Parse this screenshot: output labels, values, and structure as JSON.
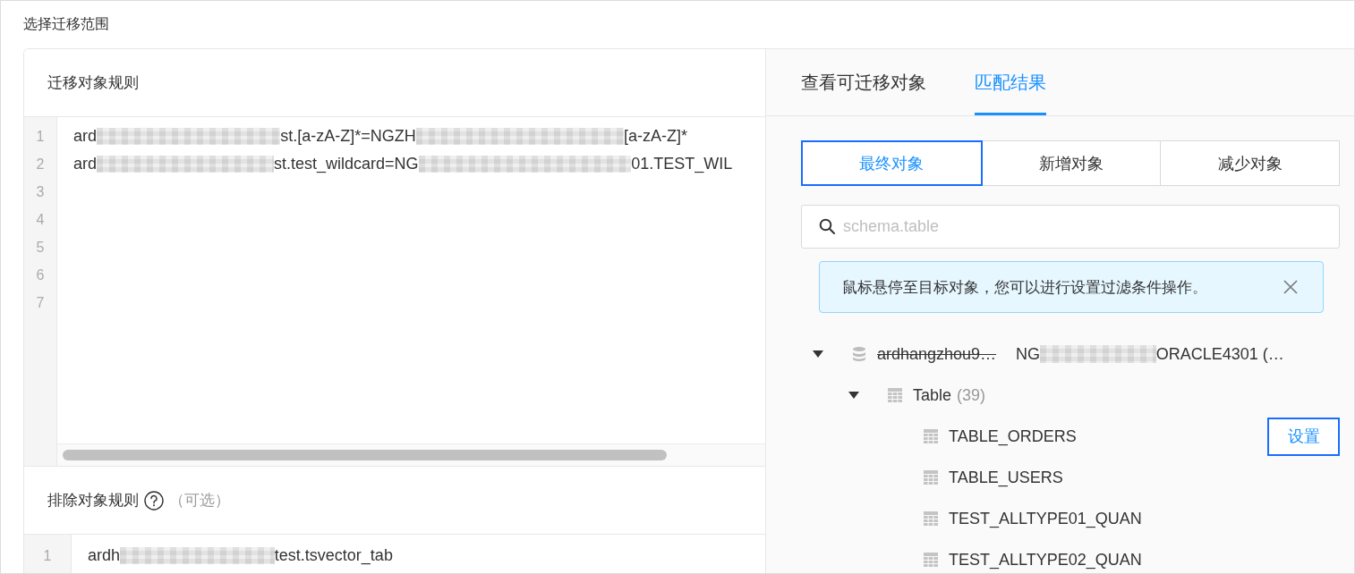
{
  "title": "选择迁移范围",
  "rules": {
    "label": "迁移对象规则",
    "lines": [
      {
        "number": "1",
        "segments": [
          {
            "kind": "text",
            "text": "ard"
          },
          {
            "kind": "blur"
          },
          {
            "kind": "text",
            "text": "st.[a-zA-Z]*=NGZH"
          },
          {
            "kind": "blur"
          },
          {
            "kind": "text",
            "text": "[a-zA-Z]*"
          }
        ]
      },
      {
        "number": "2",
        "segments": [
          {
            "kind": "text",
            "text": "ard"
          },
          {
            "kind": "blur"
          },
          {
            "kind": "text",
            "text": "st.test_wildcard=NG"
          },
          {
            "kind": "blur"
          },
          {
            "kind": "text",
            "text": "01.TEST_WIL"
          }
        ]
      },
      {
        "number": "3"
      },
      {
        "number": "4"
      },
      {
        "number": "5"
      },
      {
        "number": "6"
      },
      {
        "number": "7"
      }
    ]
  },
  "exclude": {
    "label": "排除对象规则",
    "optional": "（可选）",
    "lines": [
      {
        "number": "1",
        "segments": [
          {
            "kind": "text",
            "text": "ardh"
          },
          {
            "kind": "blur"
          },
          {
            "kind": "text",
            "text": "test.tsvector_tab"
          }
        ]
      }
    ]
  },
  "tabs": [
    {
      "label": "查看可迁移对象",
      "selected": false
    },
    {
      "label": "匹配结果",
      "selected": true
    }
  ],
  "filters": [
    {
      "label": "最终对象",
      "selected": true
    },
    {
      "label": "新增对象",
      "selected": false
    },
    {
      "label": "减少对象",
      "selected": false
    }
  ],
  "search": {
    "placeholder": "schema.table"
  },
  "alert": {
    "text": "鼠标悬停至目标对象，您可以进行设置过滤条件操作。"
  },
  "tree": {
    "hover_action": "设置",
    "nodes": [
      {
        "kind": "database",
        "label": "ardhangzhou9…",
        "struck": true,
        "expanded": true,
        "target": [
          {
            "kind": "text",
            "text": "NG"
          },
          {
            "kind": "blur"
          },
          {
            "kind": "text",
            "text": "ORACLE4301 (…"
          }
        ],
        "children": [
          {
            "kind": "group",
            "label": "Table",
            "count": "(39)",
            "expanded": true,
            "children": [
              {
                "kind": "table",
                "label": "TABLE_ORDERS",
                "hovered": true
              },
              {
                "kind": "table",
                "label": "TABLE_USERS",
                "hovered": false
              },
              {
                "kind": "table",
                "label": "TEST_ALLTYPE01_QUAN",
                "hovered": false
              },
              {
                "kind": "table",
                "label": "TEST_ALLTYPE02_QUAN",
                "hovered": false
              }
            ]
          }
        ]
      }
    ]
  }
}
